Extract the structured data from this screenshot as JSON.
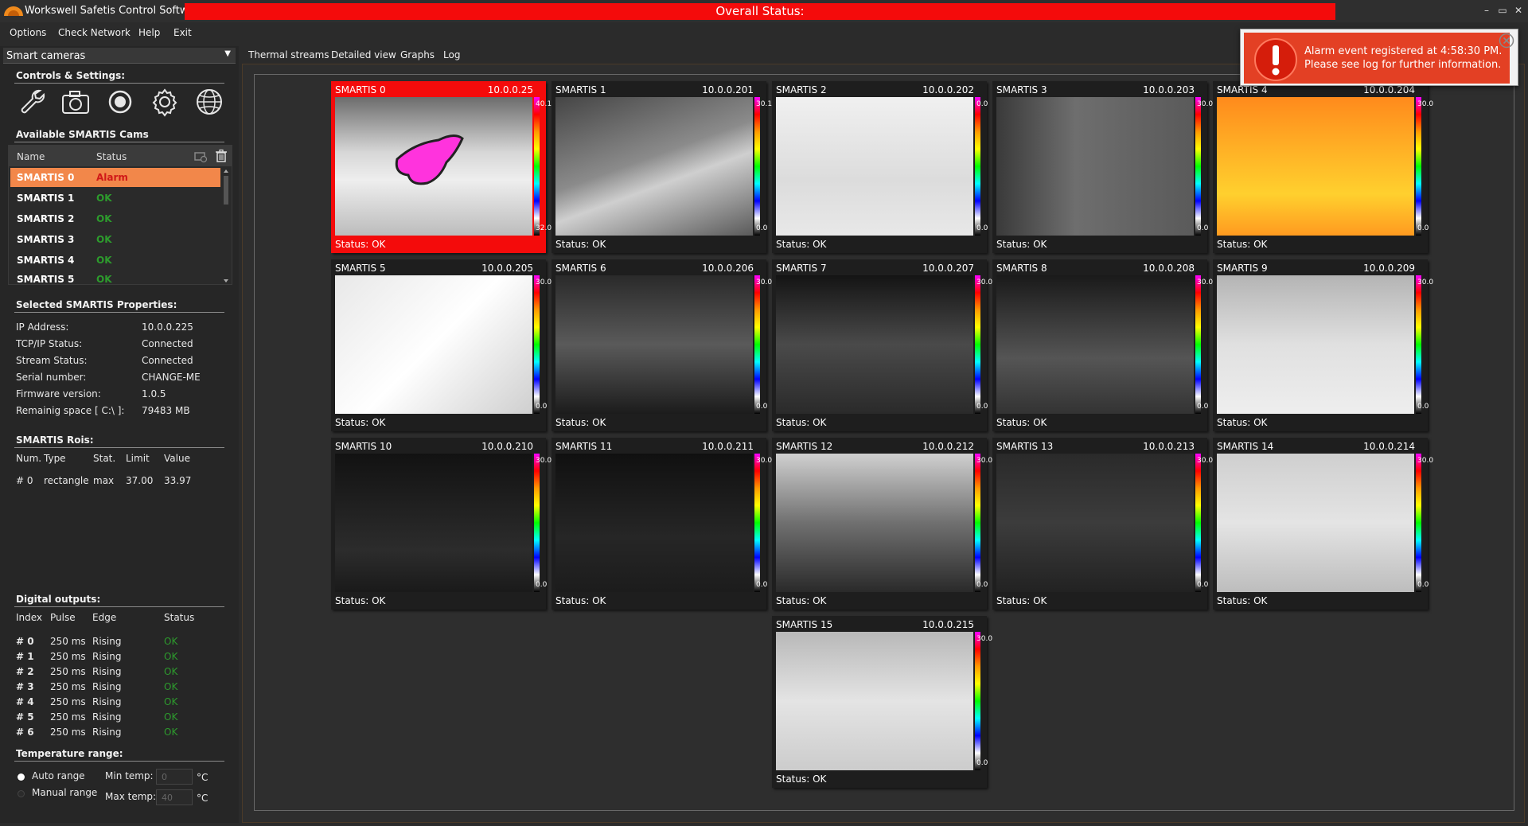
{
  "app": {
    "title": "Workswell Safetis Control Software",
    "overall_status_label": "Overall Status:",
    "window_buttons": [
      "–",
      "▭",
      "✕"
    ]
  },
  "menu": [
    "Options",
    "Check Network",
    "Help",
    "Exit"
  ],
  "left": {
    "dropdown_value": "Smart cameras",
    "controls_title": "Controls & Settings:",
    "tool_icons": [
      "wrench-icon",
      "camera-icon",
      "record-icon",
      "gear-icon",
      "network-globe-icon"
    ],
    "cams_title": "Available SMARTIS Cams",
    "cams_header": {
      "name": "Name",
      "status": "Status"
    },
    "cams": [
      {
        "name": "SMARTIS 0",
        "status": "Alarm"
      },
      {
        "name": "SMARTIS 1",
        "status": "OK"
      },
      {
        "name": "SMARTIS 2",
        "status": "OK"
      },
      {
        "name": "SMARTIS 3",
        "status": "OK"
      },
      {
        "name": "SMARTIS 4",
        "status": "OK"
      },
      {
        "name": "SMARTIS 5",
        "status": "OK"
      }
    ],
    "props_title": "Selected SMARTIS Properties:",
    "props": [
      {
        "label": "IP Address:",
        "value": "10.0.0.225"
      },
      {
        "label": "TCP/IP Status:",
        "value": "Connected"
      },
      {
        "label": "Stream Status:",
        "value": "Connected"
      },
      {
        "label": "Serial number:",
        "value": "CHANGE-ME"
      },
      {
        "label": "Firmware version:",
        "value": "1.0.5"
      },
      {
        "label": "Remainig space [ C:\\  ]:",
        "value": "79483 MB"
      }
    ],
    "rois_title": "SMARTIS Rois:",
    "rois_header": {
      "num": "Num.",
      "type": "Type",
      "stat": "Stat.",
      "limit": "Limit",
      "value": "Value"
    },
    "rois": [
      {
        "num": "# 0",
        "type": "rectangle",
        "stat": "max",
        "limit": "37.00",
        "value": "33.97"
      }
    ],
    "dout_title": "Digital outputs:",
    "dout_header": {
      "index": "Index",
      "pulse": "Pulse",
      "edge": "Edge",
      "status": "Status"
    },
    "dout": [
      {
        "index": "# 0",
        "pulse": "250 ms",
        "edge": "Rising",
        "status": "OK"
      },
      {
        "index": "# 1",
        "pulse": "250 ms",
        "edge": "Rising",
        "status": "OK"
      },
      {
        "index": "# 2",
        "pulse": "250 ms",
        "edge": "Rising",
        "status": "OK"
      },
      {
        "index": "# 3",
        "pulse": "250 ms",
        "edge": "Rising",
        "status": "OK"
      },
      {
        "index": "# 4",
        "pulse": "250 ms",
        "edge": "Rising",
        "status": "OK"
      },
      {
        "index": "# 5",
        "pulse": "250 ms",
        "edge": "Rising",
        "status": "OK"
      },
      {
        "index": "# 6",
        "pulse": "250 ms",
        "edge": "Rising",
        "status": "OK"
      }
    ],
    "temp_title": "Temperature range:",
    "temp": {
      "auto_label": "Auto range",
      "manual_label": "Manual range",
      "min_label": "Min temp:",
      "max_label": "Max temp:",
      "min_value": "0",
      "max_value": "40",
      "unit": "°C",
      "selected": "auto"
    }
  },
  "tabs": [
    "Thermal streams",
    "Detailed view",
    "Graphs",
    "Log"
  ],
  "tiles": [
    {
      "name": "SMARTIS 0",
      "ip": "10.0.0.25",
      "status": "Status: OK",
      "alarm": true,
      "cmax": "40.1",
      "cmin": "32.0"
    },
    {
      "name": "SMARTIS 1",
      "ip": "10.0.0.201",
      "status": "Status: OK",
      "cmax": "30.1",
      "cmin": "0.0"
    },
    {
      "name": "SMARTIS 2",
      "ip": "10.0.0.202",
      "status": "Status: OK",
      "cmax": "0.0",
      "cmin": "0.0"
    },
    {
      "name": "SMARTIS 3",
      "ip": "10.0.0.203",
      "status": "Status: OK",
      "cmax": "30.0",
      "cmin": "0.0"
    },
    {
      "name": "SMARTIS 4",
      "ip": "10.0.0.204",
      "status": "Status: OK",
      "cmax": "30.0",
      "cmin": "0.0"
    },
    {
      "name": "SMARTIS 5",
      "ip": "10.0.0.205",
      "status": "Status: OK",
      "cmax": "30.0",
      "cmin": "0.0"
    },
    {
      "name": "SMARTIS 6",
      "ip": "10.0.0.206",
      "status": "Status: OK",
      "cmax": "30.0",
      "cmin": "0.0"
    },
    {
      "name": "SMARTIS 7",
      "ip": "10.0.0.207",
      "status": "Status: OK",
      "cmax": "30.0",
      "cmin": "0.0"
    },
    {
      "name": "SMARTIS 8",
      "ip": "10.0.0.208",
      "status": "Status: OK",
      "cmax": "30.0",
      "cmin": "0.0"
    },
    {
      "name": "SMARTIS 9",
      "ip": "10.0.0.209",
      "status": "Status: OK",
      "cmax": "30.0",
      "cmin": "0.0"
    },
    {
      "name": "SMARTIS 10",
      "ip": "10.0.0.210",
      "status": "Status: OK",
      "cmax": "30.0",
      "cmin": "0.0"
    },
    {
      "name": "SMARTIS 11",
      "ip": "10.0.0.211",
      "status": "Status: OK",
      "cmax": "30.0",
      "cmin": "0.0"
    },
    {
      "name": "SMARTIS 12",
      "ip": "10.0.0.212",
      "status": "Status: OK",
      "cmax": "30.0",
      "cmin": "0.0"
    },
    {
      "name": "SMARTIS 13",
      "ip": "10.0.0.213",
      "status": "Status: OK",
      "cmax": "30.0",
      "cmin": "0.0"
    },
    {
      "name": "SMARTIS 14",
      "ip": "10.0.0.214",
      "status": "Status: OK",
      "cmax": "30.0",
      "cmin": "0.0"
    },
    {
      "name": "SMARTIS 15",
      "ip": "10.0.0.215",
      "status": "Status: OK",
      "cmax": "30.0",
      "cmin": "0.0"
    }
  ],
  "toast": {
    "line1": "Alarm event registered at 4:58:30 PM.",
    "line2": "Please see log for further information."
  },
  "colors": {
    "alarm_red": "#f40b0b",
    "ok_green": "#2d9b2d",
    "selected_row": "#f2874a",
    "toast_bg": "#e34024"
  }
}
